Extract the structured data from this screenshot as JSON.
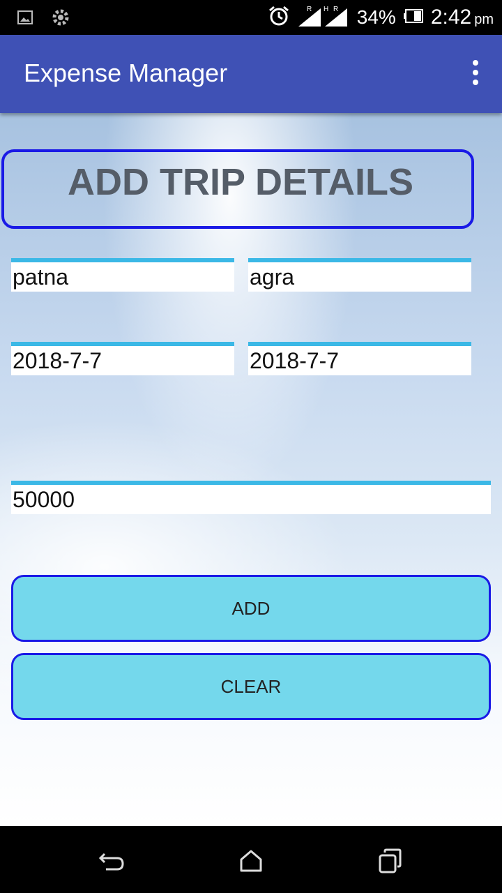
{
  "status_bar": {
    "battery_percent": "34%",
    "time": "2:42",
    "ampm": "pm",
    "icons": [
      "image-icon",
      "settings-icon",
      "alarm-icon",
      "signal-icon",
      "battery-icon"
    ]
  },
  "app_bar": {
    "title": "Expense Manager",
    "menu_icon": "overflow-menu-icon"
  },
  "form": {
    "header": "ADD TRIP DETAILS",
    "from": "patna",
    "to": "agra",
    "start_date": "2018-7-7",
    "end_date": "2018-7-7",
    "amount": "50000"
  },
  "buttons": {
    "add": "ADD",
    "clear": "CLEAR"
  },
  "nav_bar": {
    "icons": [
      "back-icon",
      "home-icon",
      "recents-icon"
    ]
  },
  "colors": {
    "app_bar": "#3f51b5",
    "button_fill": "#74d8ec",
    "button_border": "#1a1ae6",
    "field_accent": "#3bb8e6"
  }
}
